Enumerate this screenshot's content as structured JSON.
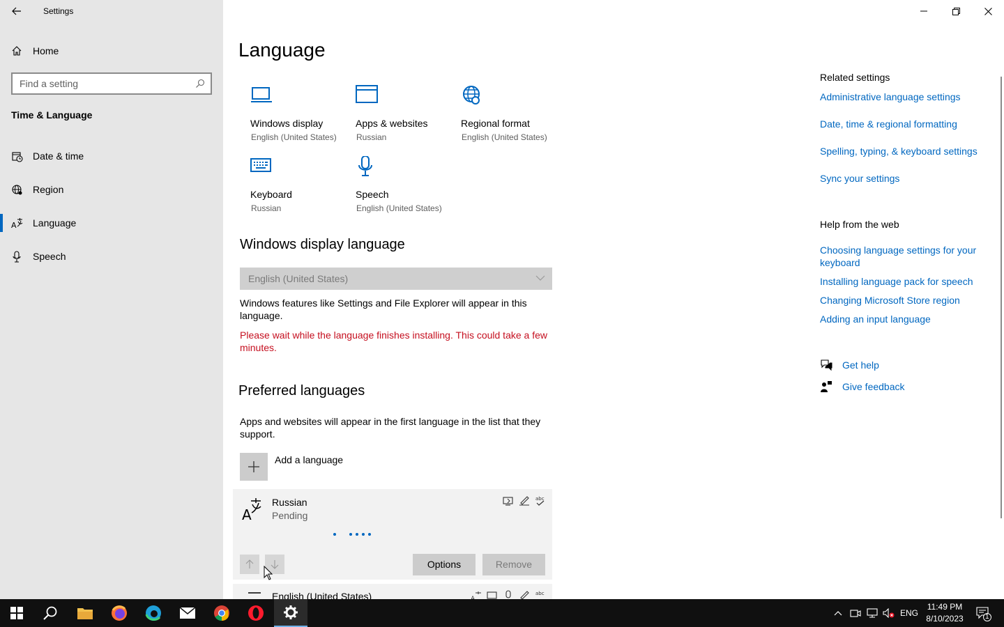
{
  "window": {
    "title": "Settings",
    "minimize_icon": "minimize-icon",
    "restore_icon": "restore-icon",
    "close_icon": "close-icon"
  },
  "sidebar": {
    "home_label": "Home",
    "search_placeholder": "Find a setting",
    "section_title": "Time & Language",
    "items": [
      {
        "label": "Date & time",
        "icon": "calendar-clock-icon",
        "active": false
      },
      {
        "label": "Region",
        "icon": "globe-icon",
        "active": false
      },
      {
        "label": "Language",
        "icon": "language-icon",
        "active": true
      },
      {
        "label": "Speech",
        "icon": "microphone-icon",
        "active": false
      }
    ]
  },
  "main": {
    "title": "Language",
    "tiles": [
      {
        "name": "Windows display",
        "value": "English (United States)",
        "icon": "monitor-icon"
      },
      {
        "name": "Apps & websites",
        "value": "Russian",
        "icon": "window-icon"
      },
      {
        "name": "Regional format",
        "value": "English (United States)",
        "icon": "globe-settings-icon"
      },
      {
        "name": "Keyboard",
        "value": "Russian",
        "icon": "keyboard-icon"
      },
      {
        "name": "Speech",
        "value": "English (United States)",
        "icon": "microphone-icon"
      }
    ],
    "display_language": {
      "heading": "Windows display language",
      "selected": "English (United States)",
      "description": "Windows features like Settings and File Explorer will appear in this language.",
      "warning": "Please wait while the language finishes installing. This could take a few minutes."
    },
    "preferred": {
      "heading": "Preferred languages",
      "description": "Apps and websites will appear in the first language in the list that they support.",
      "add_label": "Add a language",
      "languages": [
        {
          "name": "Russian",
          "status": "Pending"
        },
        {
          "name": "English (United States)",
          "status": ""
        }
      ],
      "options_label": "Options",
      "remove_label": "Remove"
    }
  },
  "related": {
    "title": "Related settings",
    "links": [
      "Administrative language settings",
      "Date, time & regional formatting",
      "Spelling, typing, & keyboard settings",
      "Sync your settings"
    ]
  },
  "help": {
    "title": "Help from the web",
    "links": [
      "Choosing language settings for your keyboard",
      "Installing language pack for speech",
      "Changing Microsoft Store region",
      "Adding an input language"
    ],
    "get_help": "Get help",
    "give_feedback": "Give feedback"
  },
  "taskbar": {
    "apps": [
      "start-icon",
      "search-icon",
      "file-explorer-icon",
      "firefox-icon",
      "edge-icon",
      "mail-icon",
      "chrome-icon",
      "opera-icon",
      "settings-icon"
    ],
    "input_language": "ENG",
    "time": "11:49 PM",
    "date": "8/10/2023",
    "notification_count": "1"
  },
  "colors": {
    "accent": "#0067c0",
    "warning": "#c50f1f",
    "sidebar_bg": "#e6e6e6",
    "taskbar_bg": "#101010"
  }
}
